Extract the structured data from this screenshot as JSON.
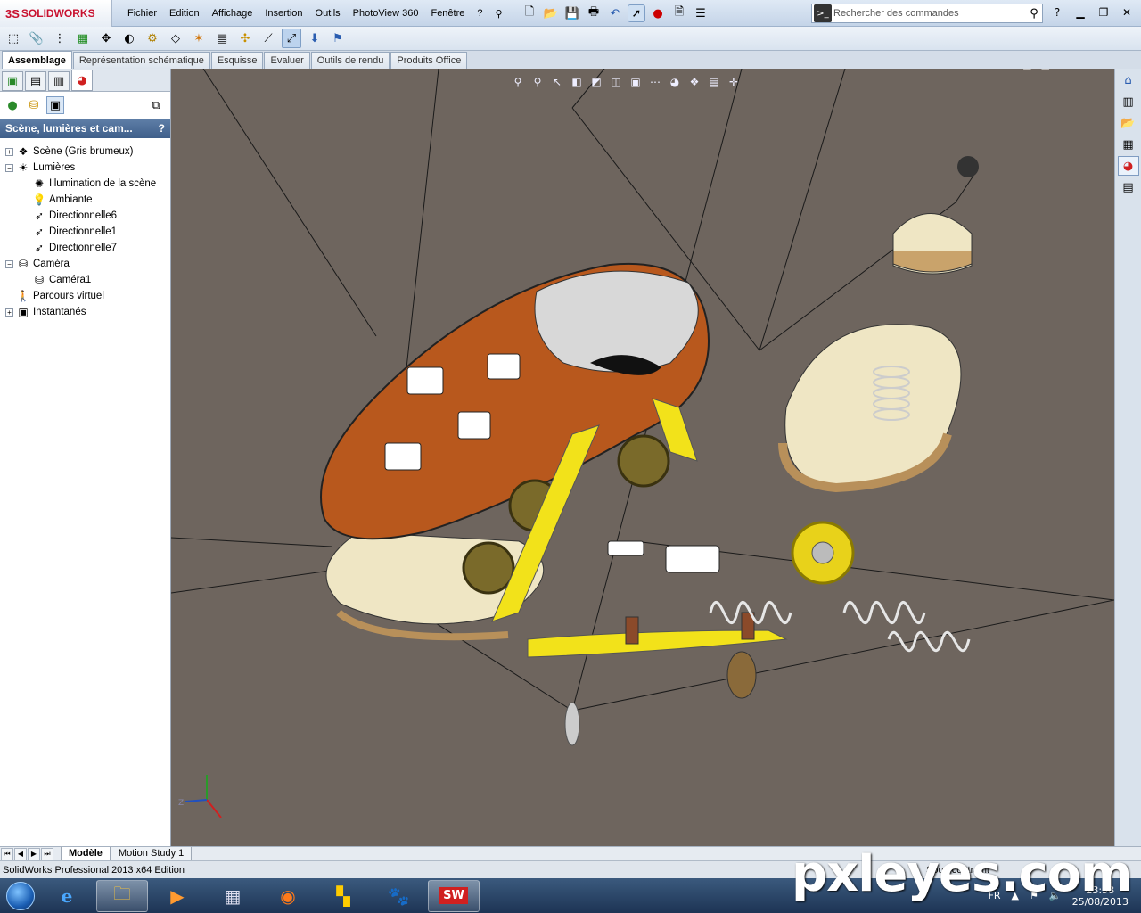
{
  "app": {
    "logo_ds": "3S",
    "logo_name": "SOLIDWORKS",
    "menus": [
      "Fichier",
      "Edition",
      "Affichage",
      "Insertion",
      "Outils",
      "PhotoView 360",
      "Fenêtre",
      "?"
    ],
    "search_placeholder": "Rechercher des commandes"
  },
  "command_tabs": [
    "Assemblage",
    "Représentation schématique",
    "Esquisse",
    "Evaluer",
    "Outils de rendu",
    "Produits Office"
  ],
  "panel": {
    "title": "Scène, lumières et cam...",
    "help": "?",
    "tree": [
      {
        "label": "Scène (Gris brumeux)",
        "level": 0,
        "expander": "+",
        "icon": "scene-icon"
      },
      {
        "label": "Lumières",
        "level": 0,
        "expander": "−",
        "icon": "lights-folder-icon"
      },
      {
        "label": "Illumination de la scène",
        "level": 1,
        "expander": "",
        "icon": "sun-icon"
      },
      {
        "label": "Ambiante",
        "level": 1,
        "expander": "",
        "icon": "bulb-icon"
      },
      {
        "label": "Directionnelle6",
        "level": 1,
        "expander": "",
        "icon": "directional-light-icon"
      },
      {
        "label": "Directionnelle1",
        "level": 1,
        "expander": "",
        "icon": "directional-light-icon"
      },
      {
        "label": "Directionnelle7",
        "level": 1,
        "expander": "",
        "icon": "directional-light-icon"
      },
      {
        "label": "Caméra",
        "level": 0,
        "expander": "−",
        "icon": "camera-folder-icon"
      },
      {
        "label": "Caméra1",
        "level": 1,
        "expander": "",
        "icon": "camera-icon"
      },
      {
        "label": "Parcours virtuel",
        "level": 0,
        "expander": "",
        "icon": "walkthrough-icon"
      },
      {
        "label": "Instantanés",
        "level": 0,
        "expander": "+",
        "icon": "snapshot-icon"
      }
    ]
  },
  "bottom_tabs": [
    "Modèle",
    "Motion Study 1"
  ],
  "status": {
    "left": "SolidWorks Professional 2013 x64 Edition",
    "right": "Sous-contraint"
  },
  "taskbar": {
    "lang": "FR",
    "time": "23:58",
    "date": "25/08/2013"
  },
  "watermark": "pxleyes.com"
}
